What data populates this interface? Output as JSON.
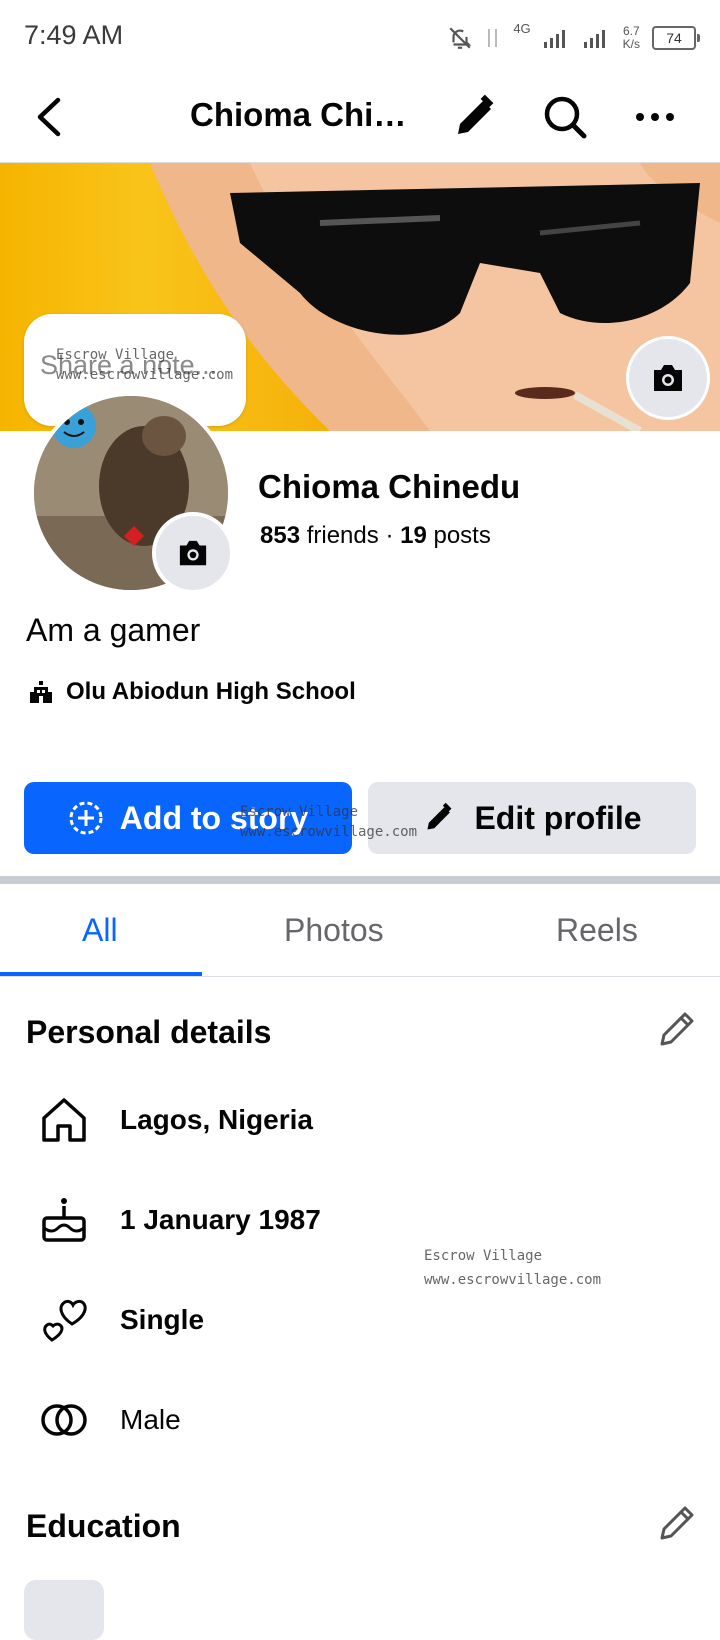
{
  "status": {
    "time": "7:49 AM",
    "network": "4G",
    "speed_value": "6.7",
    "speed_unit": "K/s",
    "battery": "74"
  },
  "header": {
    "title": "Chioma Chin..."
  },
  "note": {
    "placeholder": "Share a note..."
  },
  "profile": {
    "name": "Chioma Chinedu",
    "friends_count": "853",
    "friends_label": "friends",
    "separator": "·",
    "posts_count": "19",
    "posts_label": "posts",
    "bio": "Am a gamer",
    "school": "Olu Abiodun High School"
  },
  "actions": {
    "add_story": "Add to story",
    "edit_profile": "Edit profile"
  },
  "tabs": [
    {
      "label": "All"
    },
    {
      "label": "Photos"
    },
    {
      "label": "Reels"
    }
  ],
  "personal_details": {
    "title": "Personal details",
    "items": [
      {
        "icon": "home-icon",
        "text": "Lagos, Nigeria"
      },
      {
        "icon": "birthday-cake-icon",
        "text": "1 January 1987"
      },
      {
        "icon": "relationship-hearts-icon",
        "text": "Single"
      },
      {
        "icon": "gender-rings-icon",
        "text": "Male"
      }
    ]
  },
  "education": {
    "title": "Education"
  },
  "watermark": {
    "name": "Escrow Village",
    "url": "www.escrowvillage.com"
  },
  "colors": {
    "primary": "#0866ff",
    "secondary_button": "#e4e6eb",
    "cover": "#f6b400"
  }
}
